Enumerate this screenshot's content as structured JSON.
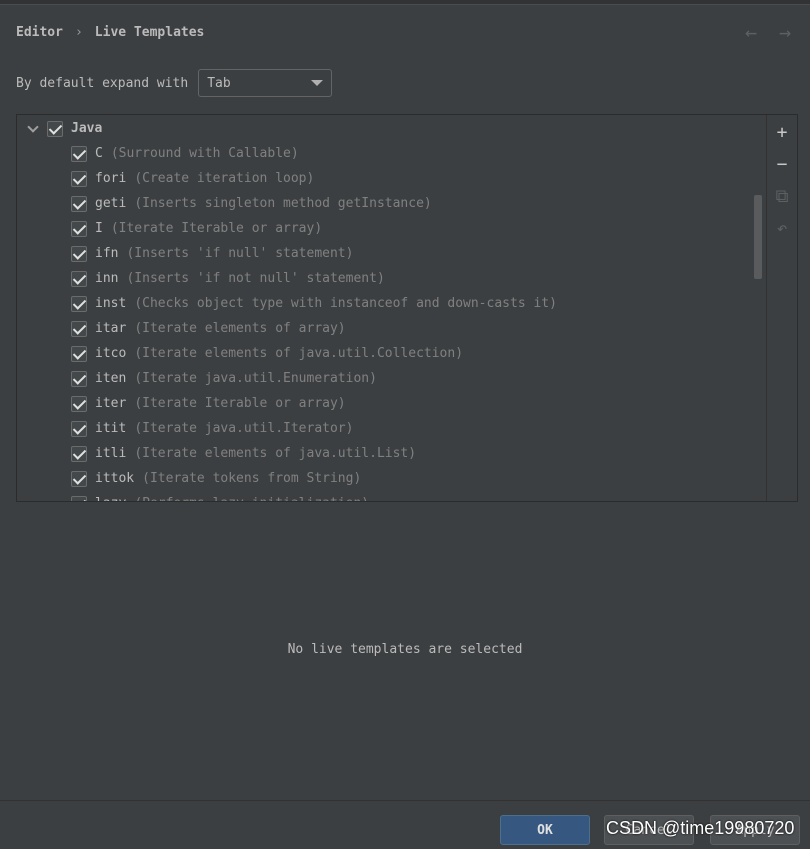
{
  "breadcrumb": {
    "parent": "Editor",
    "separator": "›",
    "current": "Live Templates"
  },
  "nav": {
    "back_icon": "←",
    "forward_icon": "→"
  },
  "expand": {
    "label": "By default expand with",
    "value": "Tab"
  },
  "tree": {
    "group": {
      "label": "Java",
      "checked": true,
      "expanded": true
    },
    "items": [
      {
        "abbr": "C",
        "desc": "(Surround with Callable)",
        "checked": true
      },
      {
        "abbr": "fori",
        "desc": "(Create iteration loop)",
        "checked": true
      },
      {
        "abbr": "geti",
        "desc": "(Inserts singleton method getInstance)",
        "checked": true
      },
      {
        "abbr": "I",
        "desc": "(Iterate Iterable or array)",
        "checked": true
      },
      {
        "abbr": "ifn",
        "desc": "(Inserts 'if null' statement)",
        "checked": true
      },
      {
        "abbr": "inn",
        "desc": "(Inserts 'if not null' statement)",
        "checked": true
      },
      {
        "abbr": "inst",
        "desc": "(Checks object type with instanceof and down-casts it)",
        "checked": true
      },
      {
        "abbr": "itar",
        "desc": "(Iterate elements of array)",
        "checked": true
      },
      {
        "abbr": "itco",
        "desc": "(Iterate elements of java.util.Collection)",
        "checked": true
      },
      {
        "abbr": "iten",
        "desc": "(Iterate java.util.Enumeration)",
        "checked": true
      },
      {
        "abbr": "iter",
        "desc": "(Iterate Iterable or array)",
        "checked": true
      },
      {
        "abbr": "itit",
        "desc": "(Iterate java.util.Iterator)",
        "checked": true
      },
      {
        "abbr": "itli",
        "desc": "(Iterate elements of java.util.List)",
        "checked": true
      },
      {
        "abbr": "ittok",
        "desc": "(Iterate tokens from String)",
        "checked": true
      },
      {
        "abbr": "lazy",
        "desc": "(Performs lazy initialization)",
        "checked": true
      }
    ]
  },
  "toolbar": {
    "add": "+",
    "remove": "−",
    "copy": "⧉",
    "restore": "↶"
  },
  "empty_message": "No live templates are selected",
  "buttons": {
    "ok": "OK",
    "cancel": "Cancel",
    "apply": "Apply"
  },
  "watermark": "CSDN @time19980720"
}
